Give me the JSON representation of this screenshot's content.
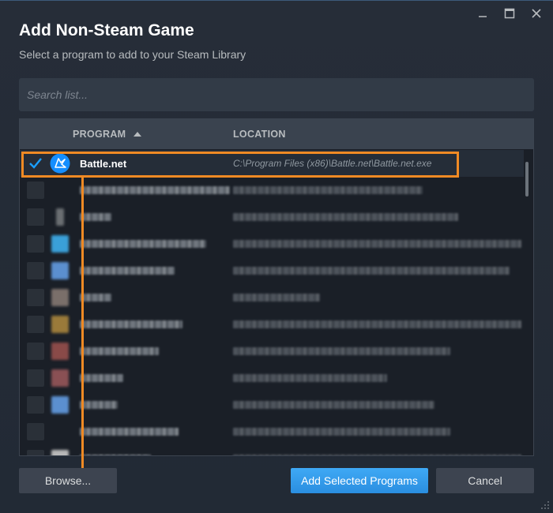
{
  "window": {
    "title": "Add Non-Steam Game",
    "subtitle": "Select a program to add to your Steam Library"
  },
  "search": {
    "placeholder": "Search list..."
  },
  "list": {
    "columns": {
      "program": "PROGRAM",
      "location": "LOCATION"
    },
    "selected_row": {
      "name": "Battle.net",
      "location": "C:\\Program Files (x86)\\Battle.net\\Battle.net.exe",
      "checked": true
    }
  },
  "buttons": {
    "browse": "Browse...",
    "add_selected": "Add Selected Programs",
    "cancel": "Cancel"
  },
  "colors": {
    "accent_blue": "#1a9fff",
    "highlight_orange": "#f08a24",
    "background": "#222a35"
  }
}
